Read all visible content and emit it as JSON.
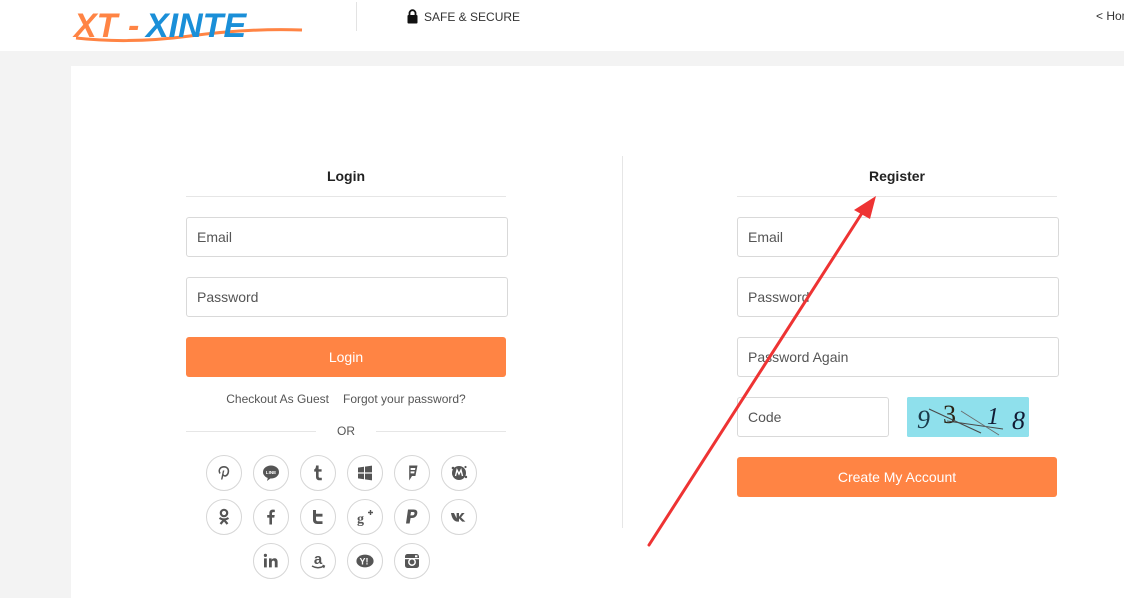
{
  "header": {
    "logo_text": "XT-XINTE",
    "secure_label": "SAFE & SECURE",
    "home_link": "< Home"
  },
  "login": {
    "title": "Login",
    "email_placeholder": "Email",
    "password_placeholder": "Password",
    "submit_label": "Login",
    "guest_link": "Checkout As Guest",
    "forgot_link": "Forgot your password?",
    "or_label": "OR",
    "social": [
      "pinterest",
      "line",
      "tumblr",
      "windows",
      "foursquare",
      "meetup",
      "odnoklassniki",
      "facebook",
      "twitter",
      "google-plus",
      "paypal",
      "vk",
      "linkedin",
      "amazon",
      "yahoo",
      "instagram"
    ]
  },
  "register": {
    "title": "Register",
    "email_placeholder": "Email",
    "password_placeholder": "Password",
    "password_again_placeholder": "Password Again",
    "code_placeholder": "Code",
    "captcha_value": "9318",
    "submit_label": "Create My Account"
  },
  "colors": {
    "accent": "#ff8444",
    "logo_blue": "#1a8fd8",
    "annotation_red": "#ee3333"
  }
}
